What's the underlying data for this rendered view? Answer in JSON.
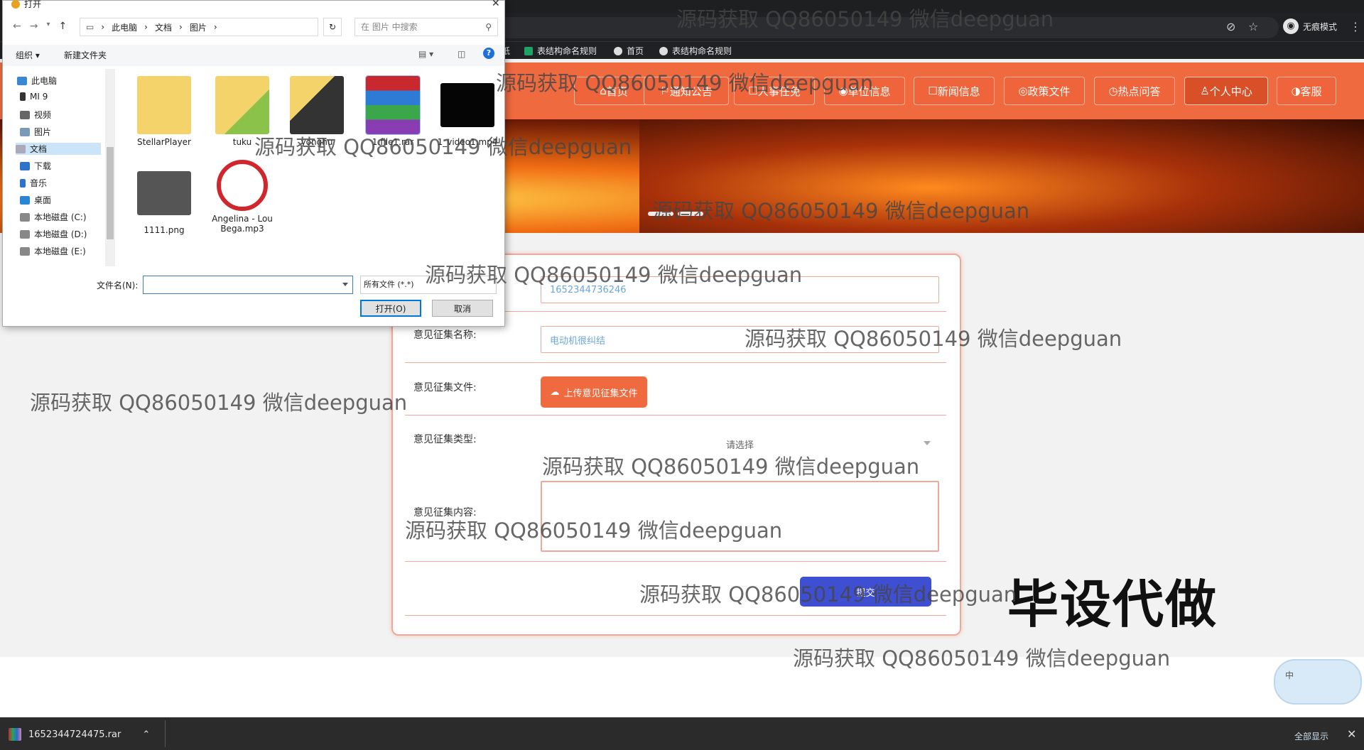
{
  "browser": {
    "incognito_label": "无痕模式",
    "bookmarks": [
      {
        "label": "纸",
        "icon": "green-sheet-icon"
      },
      {
        "label": "表结构命名规则",
        "icon": "green-sheet-icon"
      },
      {
        "label": "首页",
        "icon": "globe-icon"
      },
      {
        "label": "表结构命名规则",
        "icon": "globe-icon"
      }
    ]
  },
  "nav": {
    "items": [
      {
        "label": "首页",
        "glyph": "⌂"
      },
      {
        "label": "通知公告",
        "glyph": "⚐"
      },
      {
        "label": "人事任免",
        "glyph": "☐"
      },
      {
        "label": "单位信息",
        "glyph": "◉"
      },
      {
        "label": "新闻信息",
        "glyph": "☐"
      },
      {
        "label": "政策文件",
        "glyph": "◎"
      },
      {
        "label": "热点问答",
        "glyph": "◷"
      },
      {
        "label": "个人中心",
        "glyph": "♙"
      },
      {
        "label": "客服",
        "glyph": "◑"
      }
    ],
    "active_label": "个人中心",
    "accent": "#f06a3f"
  },
  "form": {
    "id_value": "1652344736246",
    "name_label": "意见征集名称:",
    "name_value": "电动机很纠结",
    "file_label": "意见征集文件:",
    "upload_label": "上传意见征集文件",
    "type_label": "意见征集类型:",
    "type_placeholder": "请选择",
    "content_label": "意见征集内容:",
    "submit_label": "提交"
  },
  "overlay_text": "毕设代做",
  "ime_label": "中",
  "dialog": {
    "title": "打开",
    "path": [
      "此电脑",
      "文档",
      "图片"
    ],
    "search_placeholder": "在 图片 中搜索",
    "organize_label": "组织 ▾",
    "new_folder_label": "新建文件夹",
    "tree": [
      "此电脑",
      "MI 9",
      "视频",
      "图片",
      "文档",
      "下载",
      "音乐",
      "桌面",
      "本地磁盘 (C:)",
      "本地磁盘 (D:)",
      "本地磁盘 (E:)"
    ],
    "selected_tree": "文档",
    "files": [
      {
        "name": "StellarPlayer",
        "kind": "folder"
      },
      {
        "name": "tuku",
        "kind": "folder-image"
      },
      {
        "name": "yonghu",
        "kind": "folder-photo"
      },
      {
        "name": "1.file1.rar",
        "kind": "rar"
      },
      {
        "name": "1_video1.mp4",
        "kind": "video"
      },
      {
        "name": "1111.png",
        "kind": "png"
      },
      {
        "name": "Angelina - Lou Bega.mp3",
        "kind": "music"
      }
    ],
    "filename_label": "文件名(N):",
    "filename_value": "",
    "filetype_value": "所有文件 (*.*)",
    "open_label": "打开(O)",
    "cancel_label": "取消"
  },
  "download_bar": {
    "file": "1652344724475.rar",
    "show_all": "全部显示"
  },
  "watermark": "源码获取 QQ86050149 微信deepguan"
}
